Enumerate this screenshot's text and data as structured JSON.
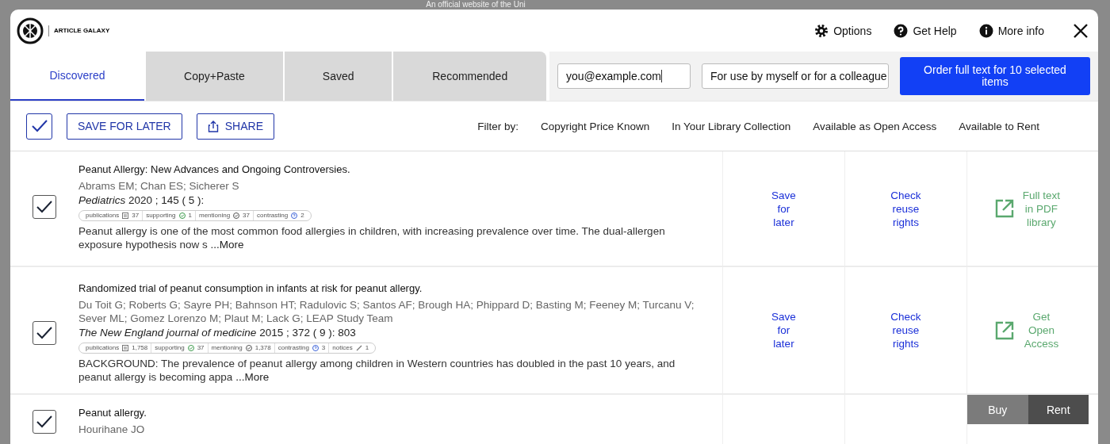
{
  "background_page": {
    "banner": "An official website of the Uni"
  },
  "header": {
    "logo_text": "ARTICLE GALAXY",
    "links": [
      {
        "kind": "gear",
        "label": "Options"
      },
      {
        "kind": "help",
        "label": "Get Help"
      },
      {
        "kind": "info",
        "label": "More info"
      }
    ]
  },
  "tabs": [
    {
      "label": "Discovered",
      "selected": true
    },
    {
      "label": "Copy+Paste",
      "selected": false
    },
    {
      "label": "Saved",
      "selected": false
    },
    {
      "label": "Recommended",
      "selected": false
    }
  ],
  "email_field": {
    "value": "you@example.com"
  },
  "use_select": {
    "value": "For use by myself or for a colleague"
  },
  "order_button": "Order full text for 10 selected items",
  "toolbar": {
    "select_all_checked": true,
    "save_button": "SAVE FOR LATER",
    "share_button": "SHARE",
    "filter_label": "Filter by:",
    "filters": [
      "Copyright Price Known",
      "In Your Library Collection",
      "Available as Open Access",
      "Available to Rent"
    ]
  },
  "results": [
    {
      "checked": true,
      "title": "Peanut Allergy: New Advances and Ongoing Controversies.",
      "authors": "Abrams EM; Chan ES; Sicherer S",
      "journal": "Pediatrics",
      "citation": "2020 ; 145 ( 5 ):",
      "badges": [
        {
          "kind": "publications",
          "label": "publications",
          "count": "37"
        },
        {
          "kind": "supporting",
          "label": "supporting",
          "count": "1"
        },
        {
          "kind": "mentioning",
          "label": "mentioning",
          "count": "37"
        },
        {
          "kind": "contrasting",
          "label": "contrasting",
          "count": "2"
        }
      ],
      "abstract": "Peanut allergy is one of the most common food allergies in children, with increasing prevalence over time. The dual-allergen exposure hypothesis now s",
      "more": "...More",
      "save_link": "Save for later",
      "rights_link": "Check reuse rights",
      "access_link": "Full text in PDF library"
    },
    {
      "checked": true,
      "title": "Randomized trial of peanut consumption in infants at risk for peanut allergy.",
      "authors": "Du Toit G; Roberts G; Sayre PH; Bahnson HT; Radulovic S; Santos AF; Brough HA; Phippard D; Basting M; Feeney M; Turcanu V; Sever ML; Gomez Lorenzo M; Plaut M; Lack G; LEAP Study Team",
      "journal": "The New England journal of medicine",
      "citation": "2015 ; 372 ( 9 ): 803",
      "badges": [
        {
          "kind": "publications",
          "label": "publications",
          "count": "1,758"
        },
        {
          "kind": "supporting",
          "label": "supporting",
          "count": "37"
        },
        {
          "kind": "mentioning",
          "label": "mentioning",
          "count": "1,378"
        },
        {
          "kind": "contrasting",
          "label": "contrasting",
          "count": "3"
        },
        {
          "kind": "notices",
          "label": "notices",
          "count": "1"
        }
      ],
      "abstract": "BACKGROUND: The prevalence of peanut allergy among children in Western countries has doubled in the past 10 years, and peanut allergy is becoming appa",
      "more": "...More",
      "save_link": "Save for later",
      "rights_link": "Check reuse rights",
      "access_link": "Get Open Access"
    },
    {
      "checked": true,
      "title": "Peanut allergy.",
      "authors": "Hourihane JO",
      "purchase_options": [
        {
          "label": "Buy",
          "selected": false
        },
        {
          "label": "Rent",
          "selected": true
        }
      ]
    }
  ]
}
